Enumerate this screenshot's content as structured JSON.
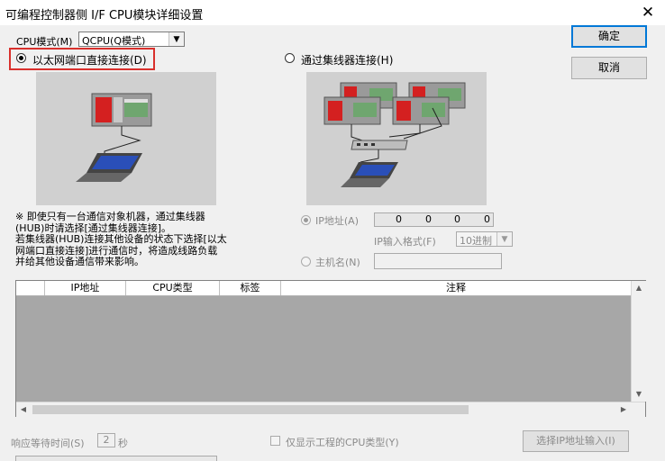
{
  "window": {
    "title": "可编程控制器侧 I/F CPU模块详细设置"
  },
  "cpu_mode": {
    "label": "CPU模式(M)",
    "value": "QCPU(Q模式)"
  },
  "buttons": {
    "ok": "确定",
    "cancel": "取消",
    "select_ip": "选择IP地址输入(I)"
  },
  "connection": {
    "direct": {
      "label": "以太网端口直接连接(D)",
      "selected": true
    },
    "hub": {
      "label": "通过集线器连接(H)",
      "selected": false
    }
  },
  "note": "※ 即使只有一台通信对象机器，通过集线器\n(HUB)时请选择[通过集线器连接]。\n若集线器(HUB)连接其他设备的状态下选择[以太\n网端口直接连接]进行通信时，将造成线路负载\n并给其他设备通信带来影响。",
  "ip": {
    "label": "IP地址(A)",
    "octets": [
      "0",
      "0",
      "0",
      "0"
    ],
    "format_label": "IP输入格式(F)",
    "format_value": "10进制"
  },
  "host": {
    "label": "主机名(N)",
    "value": ""
  },
  "table": {
    "columns": [
      "IP地址",
      "CPU类型",
      "标签",
      "注释"
    ],
    "rows": []
  },
  "response": {
    "label": "响应等待时间(S)",
    "value": "2",
    "unit": "秒"
  },
  "only_cpu": {
    "label": "仅显示工程的CPU类型(Y)",
    "checked": false
  },
  "icons": [
    "close-icon",
    "dropdown-arrow-icon",
    "plc-rack-icon",
    "laptop-icon",
    "hub-icon"
  ],
  "colors": {
    "highlight": "#d9302c",
    "default_button_border": "#0078d7"
  }
}
